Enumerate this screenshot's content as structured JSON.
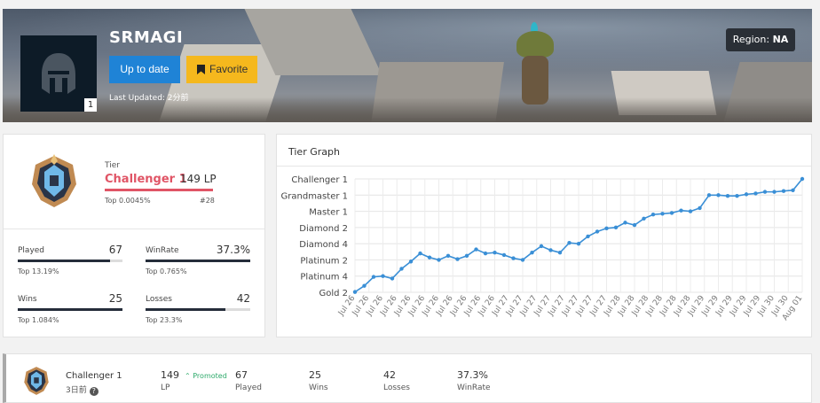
{
  "profile": {
    "name": "SRMAGI",
    "level": "1",
    "update_label": "Up to date",
    "favorite_label": "Favorite",
    "last_updated": "Last Updated: 2分前",
    "region_label": "Region:",
    "region_value": "NA"
  },
  "rank": {
    "tier_label": "Tier",
    "tier_name": "Challenger 1",
    "lp": "149 LP",
    "top_percent": "Top 0.0045%",
    "rank_no": "#28"
  },
  "stats": [
    {
      "label": "Played",
      "value": "67",
      "sub": "Top 13.19%",
      "fill": 0.88
    },
    {
      "label": "WinRate",
      "value": "37.3%",
      "sub": "Top 0.765%",
      "fill": 1.0
    },
    {
      "label": "Wins",
      "value": "25",
      "sub": "Top 1.084%",
      "fill": 1.0
    },
    {
      "label": "Losses",
      "value": "42",
      "sub": "Top 23.3%",
      "fill": 0.76
    }
  ],
  "graph": {
    "title": "Tier Graph"
  },
  "chart_data": {
    "type": "line",
    "y_categories": [
      "Gold 2",
      "Platinum 4",
      "Platinum 2",
      "Diamond 4",
      "Diamond 2",
      "Master 1",
      "Grandmaster 1",
      "Challenger 1"
    ],
    "x_tick_labels": [
      "Jul 26",
      "Jul 26",
      "Jul 26",
      "Jul 26",
      "Jul 26",
      "Jul 26",
      "Jul 26",
      "Jul 26",
      "Jul 26",
      "Jul 26",
      "Jul 26",
      "Jul 27",
      "Jul 27",
      "Jul 27",
      "Jul 27",
      "Jul 27",
      "Jul 27",
      "Jul 27",
      "Jul 27",
      "Jul 28",
      "Jul 28",
      "Jul 28",
      "Jul 28",
      "Jul 28",
      "Jul 28",
      "Jul 29",
      "Jul 29",
      "Jul 29",
      "Jul 29",
      "Jul 29",
      "Jul 30",
      "Jul 30",
      "Aug 01"
    ],
    "values": [
      0.02,
      0.4,
      0.95,
      1.0,
      0.85,
      1.45,
      1.9,
      2.4,
      2.15,
      2.0,
      2.25,
      2.05,
      2.25,
      2.65,
      2.4,
      2.45,
      2.3,
      2.1,
      2.0,
      2.45,
      2.85,
      2.6,
      2.45,
      3.05,
      3.0,
      3.45,
      3.75,
      3.95,
      4.0,
      4.3,
      4.15,
      4.55,
      4.8,
      4.85,
      4.9,
      5.05,
      5.0,
      5.2,
      6.0,
      6.0,
      5.95,
      5.95,
      6.05,
      6.1,
      6.2,
      6.2,
      6.25,
      6.3,
      7.0
    ],
    "grid": true
  },
  "season": {
    "tier": "Challenger 1",
    "time": "3日前",
    "help": "?",
    "lp_value": "149",
    "promoted": "Promoted",
    "lp_label": "LP",
    "played_value": "67",
    "played_label": "Played",
    "wins_value": "25",
    "wins_label": "Wins",
    "losses_value": "42",
    "losses_label": "Losses",
    "winrate_value": "37.3%",
    "winrate_label": "WinRate"
  },
  "colors": {
    "accent_blue": "#1f83d6",
    "favorite_yellow": "#f5b81d",
    "tier_red": "#e05566",
    "line_blue": "#3a8fd6"
  }
}
